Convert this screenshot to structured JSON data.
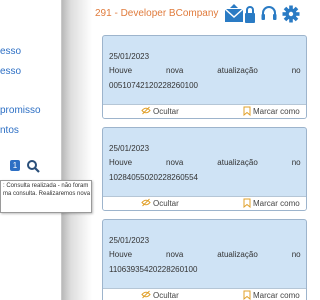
{
  "sidebar": {
    "items": [
      {
        "label": "esso"
      },
      {
        "label": "esso"
      },
      {
        "label": "promisso"
      },
      {
        "label": "ntos"
      }
    ],
    "notification_count": "1"
  },
  "tooltip": {
    "text": ": Consulta realizada - não foram ma consulta. Realizaremos nova"
  },
  "header": {
    "company": "291 - Developer BCompany"
  },
  "cards": [
    {
      "date": "25/01/2023",
      "words": [
        "Houve",
        "nova",
        "atualização",
        "no",
        "p"
      ],
      "code": "0051074212022826010​0",
      "hide_label": "Ocultar",
      "mark_label": "Marcar como"
    },
    {
      "date": "25/01/2023",
      "words": [
        "Houve",
        "nova",
        "atualização",
        "no",
        "p"
      ],
      "code": "10284055020228260554",
      "hide_label": "Ocultar",
      "mark_label": "Marcar como"
    },
    {
      "date": "25/01/2023",
      "words": [
        "Houve",
        "nova",
        "atualização",
        "no",
        "p"
      ],
      "code": "11063935420228260100",
      "hide_label": "Ocultar",
      "mark_label": "Marcar como"
    }
  ],
  "colors": {
    "accent": "#2d6fc4",
    "company": "#e07b3c",
    "card_bg": "#cfe3f5",
    "icon": "#2a7bc4"
  },
  "icons": [
    "mail-icon",
    "lock-icon",
    "headset-icon",
    "gear-icon",
    "search-icon",
    "eye-off-icon",
    "bookmark-icon"
  ]
}
